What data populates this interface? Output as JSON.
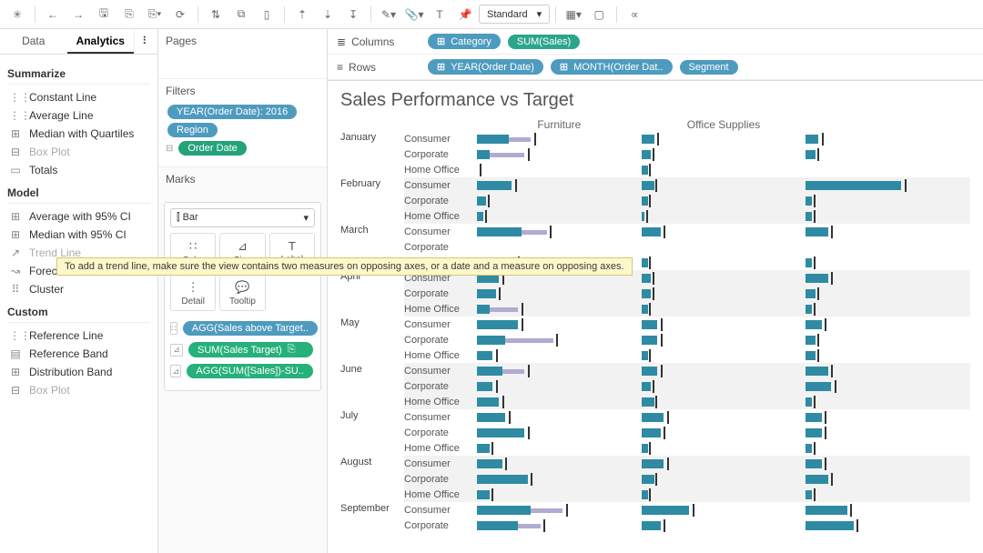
{
  "toolbar": {
    "combo_label": "Standard"
  },
  "left": {
    "tab1": "Data",
    "tab2": "Analytics",
    "sections": {
      "summarize": {
        "title": "Summarize",
        "items": [
          {
            "label": "Constant Line",
            "icon": "⋮⋮",
            "dim": false
          },
          {
            "label": "Average Line",
            "icon": "⋮⋮",
            "dim": false
          },
          {
            "label": "Median with Quartiles",
            "icon": "⊞",
            "dim": false
          },
          {
            "label": "Box Plot",
            "icon": "⊟",
            "dim": true
          },
          {
            "label": "Totals",
            "icon": "▭",
            "dim": false
          }
        ]
      },
      "model": {
        "title": "Model",
        "items": [
          {
            "label": "Average with 95% CI",
            "icon": "⊞",
            "dim": false
          },
          {
            "label": "Median with 95% CI",
            "icon": "⊞",
            "dim": false
          },
          {
            "label": "Trend Line",
            "icon": "↗",
            "dim": true
          },
          {
            "label": "Forecast",
            "icon": "↝",
            "dim": false
          },
          {
            "label": "Cluster",
            "icon": "⠿",
            "dim": false
          }
        ]
      },
      "custom": {
        "title": "Custom",
        "items": [
          {
            "label": "Reference Line",
            "icon": "⋮⋮",
            "dim": false
          },
          {
            "label": "Reference Band",
            "icon": "▤",
            "dim": false
          },
          {
            "label": "Distribution Band",
            "icon": "⊞",
            "dim": false
          },
          {
            "label": "Box Plot",
            "icon": "⊟",
            "dim": true
          }
        ]
      }
    }
  },
  "mid": {
    "pages_title": "Pages",
    "filters_title": "Filters",
    "filters": [
      {
        "label": "YEAR(Order Date): 2016",
        "cls": "blue"
      },
      {
        "label": "Region",
        "cls": "blue"
      },
      {
        "label": "Order Date",
        "cls": "teal2",
        "continuous": true
      }
    ],
    "marks_title": "Marks",
    "mark_type": "Bar",
    "mark_cells_row1": [
      "Color",
      "Size",
      "Label"
    ],
    "mark_cells_row2": [
      "Detail",
      "Tooltip"
    ],
    "mark_pills": [
      {
        "label": "AGG(Sales above Target..",
        "cls": "blue",
        "ico": "∷"
      },
      {
        "label": "SUM(Sales Target)",
        "cls": "green",
        "ico": "⊿",
        "extra": true
      },
      {
        "label": "AGG(SUM([Sales])-SU..",
        "cls": "green",
        "ico": "⊿"
      }
    ]
  },
  "shelves": {
    "columns_label": "Columns",
    "rows_label": "Rows",
    "columns": [
      {
        "label": "Category",
        "cls": "blue",
        "pre": "⊞"
      },
      {
        "label": "SUM(Sales)",
        "cls": "teal"
      }
    ],
    "rows": [
      {
        "label": "YEAR(Order Date)",
        "cls": "blue",
        "pre": "⊞"
      },
      {
        "label": "MONTH(Order Dat..",
        "cls": "blue",
        "pre": "⊞"
      },
      {
        "label": "Segment",
        "cls": "blue"
      }
    ]
  },
  "tooltip_text": "To add a trend line, make sure the view contains two measures on opposing axes, or a date and a measure on opposing axes.",
  "chart_data": {
    "type": "bar",
    "title": "Sales Performance vs Target",
    "column_headers": [
      "Furniture",
      "Office Supplies"
    ],
    "segments": [
      "Consumer",
      "Corporate",
      "Home Office"
    ],
    "months": [
      {
        "name": "January",
        "alt": false,
        "rows": [
          {
            "f_a": 20,
            "f_t": 34,
            "f_k": 36,
            "o_a": 8,
            "o_t": 4,
            "o_k": 10,
            "t_a": 8,
            "t_t": 4,
            "t_k": 10
          },
          {
            "f_a": 8,
            "f_t": 30,
            "f_k": 32,
            "o_a": 6,
            "o_t": 3,
            "o_k": 7,
            "t_a": 6,
            "t_t": 3,
            "t_k": 7
          },
          {
            "f_a": 0,
            "f_t": 0,
            "f_k": 2,
            "o_a": 4,
            "o_t": 2,
            "o_k": 5,
            "t_a": 0,
            "t_t": 0,
            "t_k": 0
          }
        ]
      },
      {
        "name": "February",
        "alt": true,
        "rows": [
          {
            "f_a": 22,
            "f_t": 10,
            "f_k": 24,
            "o_a": 8,
            "o_t": 4,
            "o_k": 9,
            "t_a": 60,
            "t_t": 30,
            "t_k": 62
          },
          {
            "f_a": 6,
            "f_t": 3,
            "f_k": 7,
            "o_a": 4,
            "o_t": 2,
            "o_k": 5,
            "t_a": 4,
            "t_t": 2,
            "t_k": 5
          },
          {
            "f_a": 4,
            "f_t": 2,
            "f_k": 5,
            "o_a": 2,
            "o_t": 1,
            "o_k": 3,
            "t_a": 4,
            "t_t": 2,
            "t_k": 5
          }
        ]
      },
      {
        "name": "March",
        "alt": false,
        "rows": [
          {
            "f_a": 28,
            "f_t": 44,
            "f_k": 46,
            "o_a": 12,
            "o_t": 6,
            "o_k": 14,
            "t_a": 14,
            "t_t": 7,
            "t_k": 16
          },
          {
            "f_a": 0,
            "f_t": 0,
            "f_k": 0,
            "o_a": 0,
            "o_t": 0,
            "o_k": 0,
            "t_a": 0,
            "t_t": 0,
            "t_k": 0
          },
          {
            "f_a": 8,
            "f_t": 24,
            "f_k": 26,
            "o_a": 4,
            "o_t": 2,
            "o_k": 5,
            "t_a": 4,
            "t_t": 2,
            "t_k": 5
          }
        ]
      },
      {
        "name": "April",
        "alt": true,
        "rows": [
          {
            "f_a": 14,
            "f_t": 7,
            "f_k": 16,
            "o_a": 6,
            "o_t": 3,
            "o_k": 7,
            "t_a": 14,
            "t_t": 7,
            "t_k": 16
          },
          {
            "f_a": 12,
            "f_t": 6,
            "f_k": 14,
            "o_a": 6,
            "o_t": 3,
            "o_k": 7,
            "t_a": 6,
            "t_t": 3,
            "t_k": 7
          },
          {
            "f_a": 8,
            "f_t": 26,
            "f_k": 28,
            "o_a": 4,
            "o_t": 2,
            "o_k": 5,
            "t_a": 4,
            "t_t": 2,
            "t_k": 5
          }
        ]
      },
      {
        "name": "May",
        "alt": false,
        "rows": [
          {
            "f_a": 26,
            "f_t": 13,
            "f_k": 28,
            "o_a": 10,
            "o_t": 5,
            "o_k": 12,
            "t_a": 10,
            "t_t": 5,
            "t_k": 12
          },
          {
            "f_a": 18,
            "f_t": 48,
            "f_k": 50,
            "o_a": 10,
            "o_t": 5,
            "o_k": 12,
            "t_a": 6,
            "t_t": 3,
            "t_k": 7
          },
          {
            "f_a": 10,
            "f_t": 5,
            "f_k": 12,
            "o_a": 4,
            "o_t": 2,
            "o_k": 5,
            "t_a": 6,
            "t_t": 3,
            "t_k": 7
          }
        ]
      },
      {
        "name": "June",
        "alt": true,
        "rows": [
          {
            "f_a": 16,
            "f_t": 30,
            "f_k": 32,
            "o_a": 10,
            "o_t": 5,
            "o_k": 12,
            "t_a": 14,
            "t_t": 7,
            "t_k": 16
          },
          {
            "f_a": 10,
            "f_t": 5,
            "f_k": 12,
            "o_a": 6,
            "o_t": 3,
            "o_k": 7,
            "t_a": 16,
            "t_t": 8,
            "t_k": 18
          },
          {
            "f_a": 14,
            "f_t": 7,
            "f_k": 16,
            "o_a": 8,
            "o_t": 4,
            "o_k": 9,
            "t_a": 4,
            "t_t": 2,
            "t_k": 5
          }
        ]
      },
      {
        "name": "July",
        "alt": false,
        "rows": [
          {
            "f_a": 18,
            "f_t": 9,
            "f_k": 20,
            "o_a": 14,
            "o_t": 7,
            "o_k": 16,
            "t_a": 10,
            "t_t": 5,
            "t_k": 12
          },
          {
            "f_a": 30,
            "f_t": 15,
            "f_k": 32,
            "o_a": 12,
            "o_t": 6,
            "o_k": 14,
            "t_a": 10,
            "t_t": 5,
            "t_k": 12
          },
          {
            "f_a": 8,
            "f_t": 4,
            "f_k": 9,
            "o_a": 4,
            "o_t": 2,
            "o_k": 5,
            "t_a": 4,
            "t_t": 2,
            "t_k": 5
          }
        ]
      },
      {
        "name": "August",
        "alt": true,
        "rows": [
          {
            "f_a": 16,
            "f_t": 8,
            "f_k": 18,
            "o_a": 14,
            "o_t": 7,
            "o_k": 16,
            "t_a": 10,
            "t_t": 5,
            "t_k": 12
          },
          {
            "f_a": 32,
            "f_t": 16,
            "f_k": 34,
            "o_a": 8,
            "o_t": 4,
            "o_k": 9,
            "t_a": 14,
            "t_t": 7,
            "t_k": 16
          },
          {
            "f_a": 8,
            "f_t": 4,
            "f_k": 9,
            "o_a": 4,
            "o_t": 2,
            "o_k": 5,
            "t_a": 4,
            "t_t": 2,
            "t_k": 5
          }
        ]
      },
      {
        "name": "September",
        "alt": false,
        "rows": [
          {
            "f_a": 34,
            "f_t": 54,
            "f_k": 56,
            "o_a": 30,
            "o_t": 15,
            "o_k": 32,
            "t_a": 26,
            "t_t": 13,
            "t_k": 28
          },
          {
            "f_a": 26,
            "f_t": 40,
            "f_k": 42,
            "o_a": 12,
            "o_t": 6,
            "o_k": 14,
            "t_a": 30,
            "t_t": 15,
            "t_k": 32
          }
        ]
      }
    ]
  }
}
